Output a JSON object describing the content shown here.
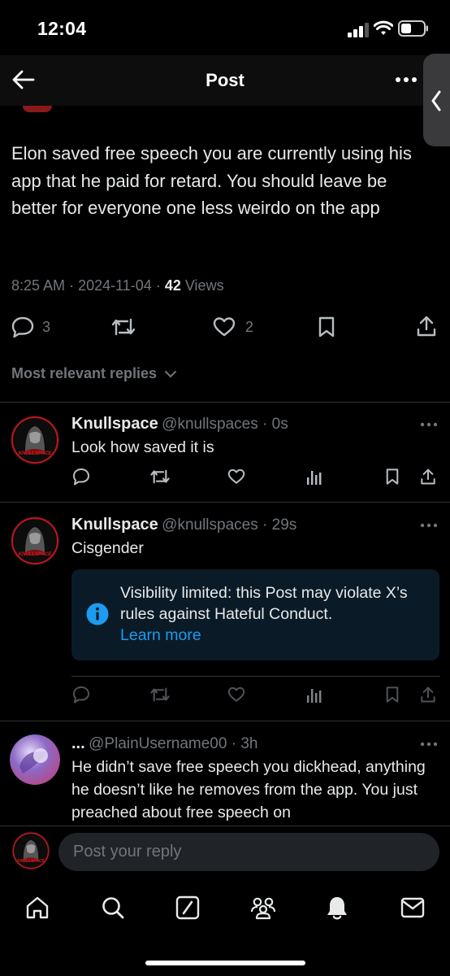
{
  "status_bar": {
    "time": "12:04"
  },
  "header": {
    "title": "Post"
  },
  "post": {
    "text": "Elon saved free speech you are currently using his app that he paid for retard. You should leave be better for everyone one less weirdo on the app",
    "time": "8:25 AM",
    "date": "2024-11-04",
    "views_count": "42",
    "views_label": "Views",
    "reply_count": "3",
    "like_count": "2"
  },
  "replies_filter": {
    "label": "Most relevant replies"
  },
  "replies": [
    {
      "name": "Knullspace",
      "handle": "@knullspaces",
      "time": "0s",
      "text": "Look how saved it is",
      "avatar_text": "KNULLSPACE"
    },
    {
      "name": "Knullspace",
      "handle": "@knullspaces",
      "time": "29s",
      "text": "Cisgender",
      "avatar_text": "KNULLSPACE",
      "notice": {
        "text": "Visibility limited: this Post may violate X’s rules against Hateful Conduct.",
        "link": "Learn more"
      }
    },
    {
      "name": "...",
      "handle": "@PlainUsername00",
      "time": "3h",
      "text": "He didn’t save free speech you dickhead, anything he doesn’t like he removes from the app. You just preached about free speech on"
    }
  ],
  "composer": {
    "placeholder": "Post your reply",
    "avatar_text": "KNULLSPACE"
  },
  "colors": {
    "accent": "#1d9bf0",
    "muted": "#71767b",
    "text": "#e7e9ea",
    "avatar_red": "#c0151b",
    "notice_bg": "#0a1b27"
  },
  "icons": [
    "back-arrow-icon",
    "more-icon",
    "reply-icon",
    "repost-icon",
    "like-icon",
    "bookmark-icon",
    "share-icon",
    "views-icon",
    "info-icon",
    "home-icon",
    "search-icon",
    "grok-icon",
    "communities-icon",
    "notifications-icon",
    "messages-icon"
  ]
}
